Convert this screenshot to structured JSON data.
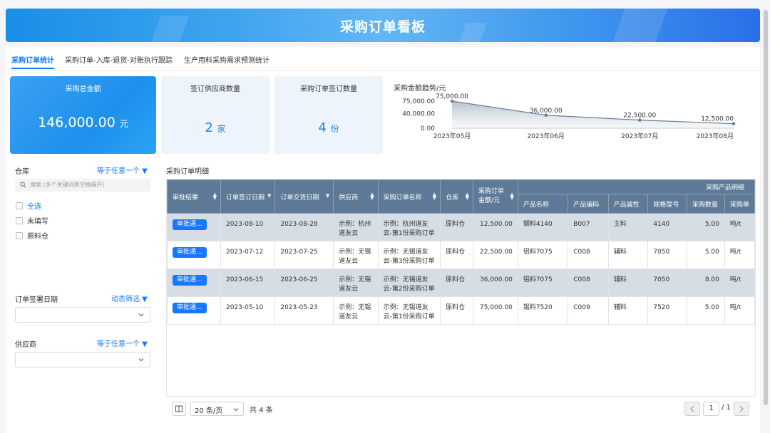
{
  "header": {
    "title": "采购订单看板"
  },
  "tabs": [
    {
      "label": "采购订单统计",
      "active": true
    },
    {
      "label": "采购订单-入库-退货-对账执行跟踪",
      "active": false
    },
    {
      "label": "生产用料采购需求预测统计",
      "active": false
    }
  ],
  "kpis": {
    "total": {
      "label": "采购总金额",
      "value": "146,000.00",
      "unit": "元"
    },
    "suppliers": {
      "label": "签订供应商数量",
      "value": "2",
      "unit": "家"
    },
    "orders": {
      "label": "采购订单签订数量",
      "value": "4",
      "unit": "份"
    }
  },
  "chart_data": {
    "type": "area",
    "title": "采购金额趋势/元",
    "categories": [
      "2023年05月",
      "2023年06月",
      "2023年07月",
      "2023年08月"
    ],
    "series": [
      {
        "values": [
          75000,
          36000,
          22500,
          12500
        ]
      }
    ],
    "data_labels": [
      "75,000.00",
      "36,000.00",
      "22,500.00",
      "12,500.00"
    ],
    "yticks": [
      "75,000.00",
      "40,000.00",
      "0.00"
    ],
    "ylim": [
      0,
      75000
    ],
    "color": "#6a7f96"
  },
  "filters": {
    "warehouse": {
      "label": "仓库",
      "op": "等于任意一个",
      "search_placeholder": "搜索 (多个关键词用空格隔开)",
      "options": [
        {
          "label": "全选",
          "selected": true
        },
        {
          "label": "未填写",
          "selected": false
        },
        {
          "label": "原料仓",
          "selected": false
        }
      ]
    },
    "sign_date": {
      "label": "订单签署日期",
      "op": "动态筛选"
    },
    "supplier": {
      "label": "供应商",
      "op": "等于任意一个"
    }
  },
  "table": {
    "title": "采购订单明细",
    "group_header": "采购产品明细",
    "headers": [
      "审批结果",
      "订单签订日期",
      "订单交货日期",
      "供应商",
      "采购订单名称",
      "仓库",
      "采购订单金额/元",
      "产品名称",
      "产品编码",
      "产品属性",
      "规格型号",
      "采购数量",
      "采购单"
    ],
    "rows": [
      {
        "status": "审批通...",
        "sign_date": "2023-08-10",
        "delivery_date": "2023-08-28",
        "supplier": "示例：杭州道友云",
        "order_name": "示例：杭州道友云-第1份采购订单",
        "warehouse": "原料仓",
        "amount": "12,500.00",
        "product_name": "钢料4140",
        "code": "B007",
        "attr": "主料",
        "spec": "4140",
        "qty": "5.00",
        "unit": "吨/t"
      },
      {
        "status": "审批通...",
        "sign_date": "2023-07-12",
        "delivery_date": "2023-07-25",
        "supplier": "示例：无锡道友云",
        "order_name": "示例：无锡道友云-第3份采购订单",
        "warehouse": "原料仓",
        "amount": "22,500.00",
        "product_name": "铝料7075",
        "code": "C008",
        "attr": "辅料",
        "spec": "7050",
        "qty": "5.00",
        "unit": "吨/t"
      },
      {
        "status": "审批通...",
        "sign_date": "2023-06-15",
        "delivery_date": "2023-06-25",
        "supplier": "示例：无锡道友云",
        "order_name": "示例：无锡道友云-第2份采购订单",
        "warehouse": "原料仓",
        "amount": "36,000.00",
        "product_name": "铝料7075",
        "code": "C008",
        "attr": "辅料",
        "spec": "7050",
        "qty": "8.00",
        "unit": "吨/t"
      },
      {
        "status": "审批通...",
        "sign_date": "2023-05-10",
        "delivery_date": "2023-05-23",
        "supplier": "示例：无锡道友云",
        "order_name": "示例：无锡道友云-第1份采购订单",
        "warehouse": "原料仓",
        "amount": "75,000.00",
        "product_name": "锡料7520",
        "code": "C009",
        "attr": "辅料",
        "spec": "7520",
        "qty": "5.00",
        "unit": "吨/t"
      }
    ]
  },
  "pagination": {
    "page_size": "20 条/页",
    "total": "共 4 条",
    "current": "1",
    "of_total": "/ 1"
  }
}
